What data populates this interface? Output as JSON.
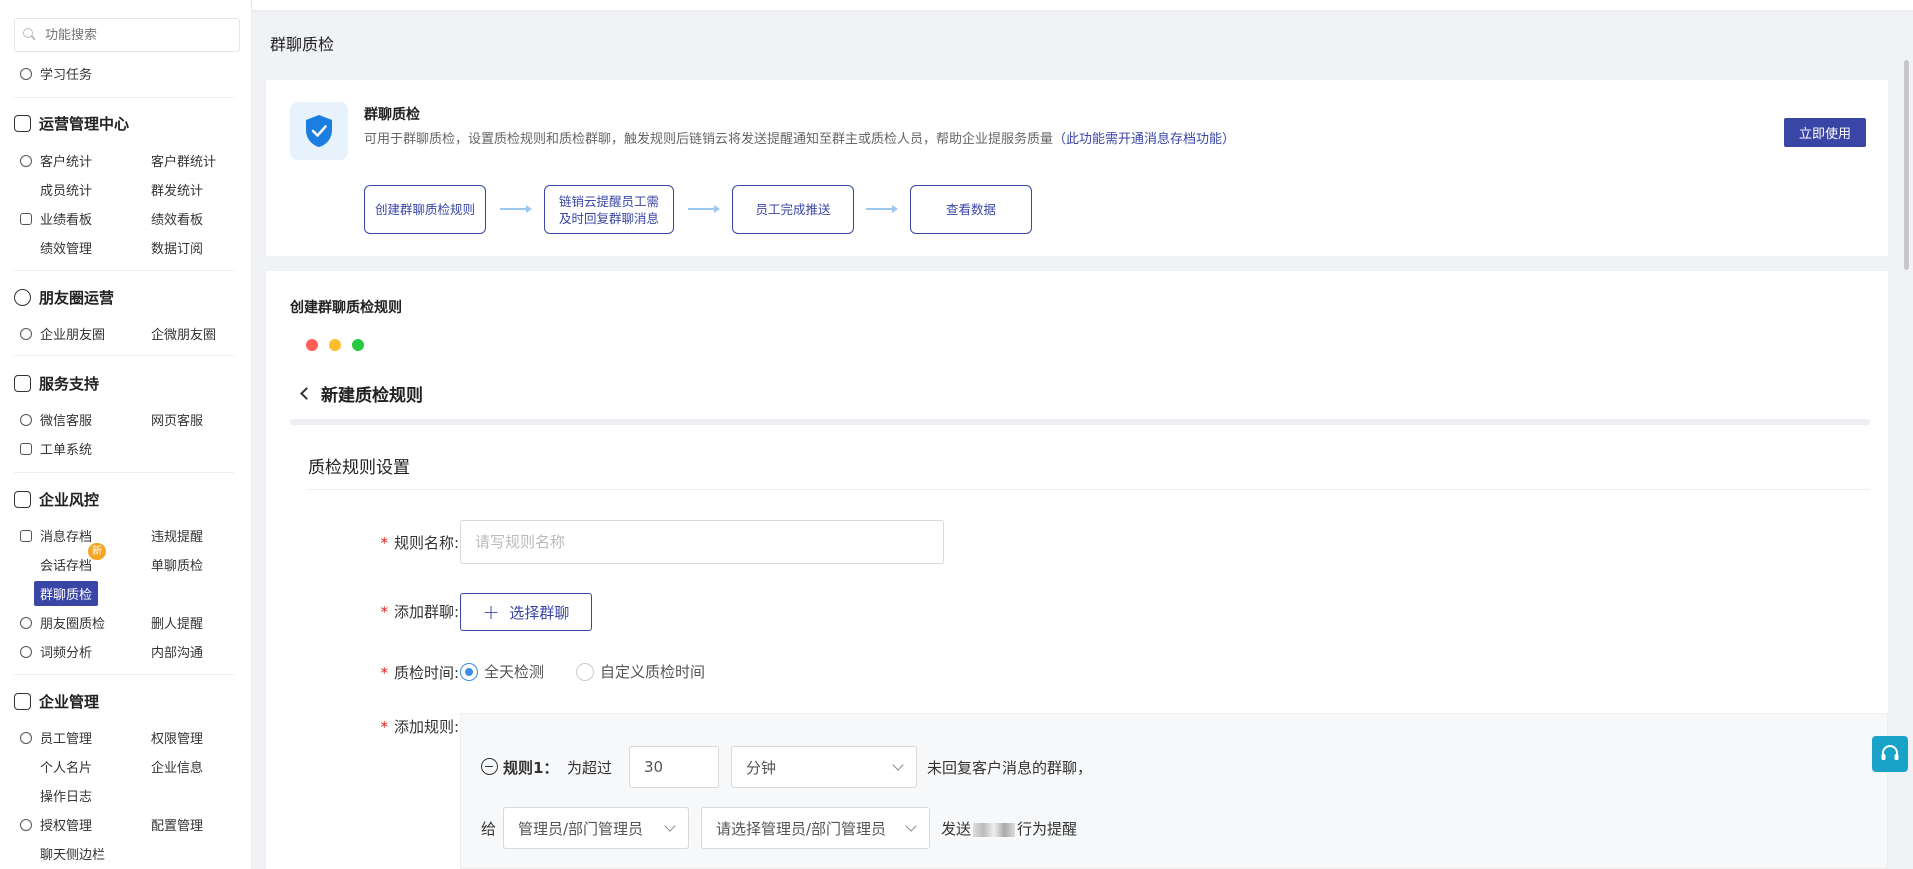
{
  "search": {
    "placeholder": "功能搜索"
  },
  "sidebar": {
    "learn": "学习任务",
    "sections": {
      "ops": "运营管理中心",
      "moments": "朋友圈运营",
      "service": "服务支持",
      "risk": "企业风控",
      "enterprise": "企业管理"
    },
    "items": {
      "customer_stats": "客户统计",
      "group_stats": "客户群统计",
      "member_stats": "成员统计",
      "mass_stats": "群发统计",
      "perf_board": "业绩看板",
      "kpi_board": "绩效看板",
      "kpi_manage": "绩效管理",
      "data_sub": "数据订阅",
      "corp_moments": "企业朋友圈",
      "wecom_moments": "企微朋友圈",
      "wechat_service": "微信客服",
      "web_service": "网页客服",
      "ticket": "工单系统",
      "msg_archive": "消息存档",
      "violation": "违规提醒",
      "session_archive": "会话存档",
      "single_qc": "单聊质检",
      "group_qc": "群聊质检",
      "moments_qc": "朋友圈质检",
      "delete_alert": "删人提醒",
      "word_freq": "词频分析",
      "internal": "内部沟通",
      "staff": "员工管理",
      "permission": "权限管理",
      "card": "个人名片",
      "corp_info": "企业信息",
      "op_log": "操作日志",
      "auth": "授权管理",
      "config": "配置管理",
      "chat_sidebar": "聊天侧边栏"
    },
    "new_badge": "新"
  },
  "page": {
    "title": "群聊质检"
  },
  "intro": {
    "title": "群聊质检",
    "desc": "可用于群聊质检，设置质检规则和质检群聊，触发规则后链销云将发送提醒通知至群主或质检人员，帮助企业提服务质量",
    "link": "（此功能需开通消息存档功能）",
    "use_button": "立即使用",
    "steps": [
      "创建群聊质检规则",
      "链销云提醒员工需",
      "及时回复群聊消息",
      "员工完成推送",
      "查看数据"
    ]
  },
  "form": {
    "section_title": "创建群聊质检规则",
    "back_label": "新建质检规则",
    "title": "质检规则设置",
    "rule_name_label": "规则名称:",
    "rule_name_placeholder": "请写规则名称",
    "add_group_label": "添加群聊:",
    "select_group_button": "选择群聊",
    "qc_time_label": "质检时间:",
    "qc_time_options": [
      "全天检测",
      "自定义质检时间"
    ],
    "qc_time_selected": "全天检测",
    "add_rule_label": "添加规则:",
    "rule": {
      "name": "规则1：",
      "prefix": "为超过",
      "minutes_value": "30",
      "unit": "分钟",
      "suffix": "未回复客户消息的群聊，",
      "give": "给",
      "role": "管理员/部门管理员",
      "role_placeholder": "请选择管理员/部门管理员",
      "send": "发送",
      "send_suffix": "行为提醒"
    }
  },
  "colors": {
    "accent": "#3a46a6",
    "link_blue": "#3a8ee6",
    "required": "#e02020"
  }
}
